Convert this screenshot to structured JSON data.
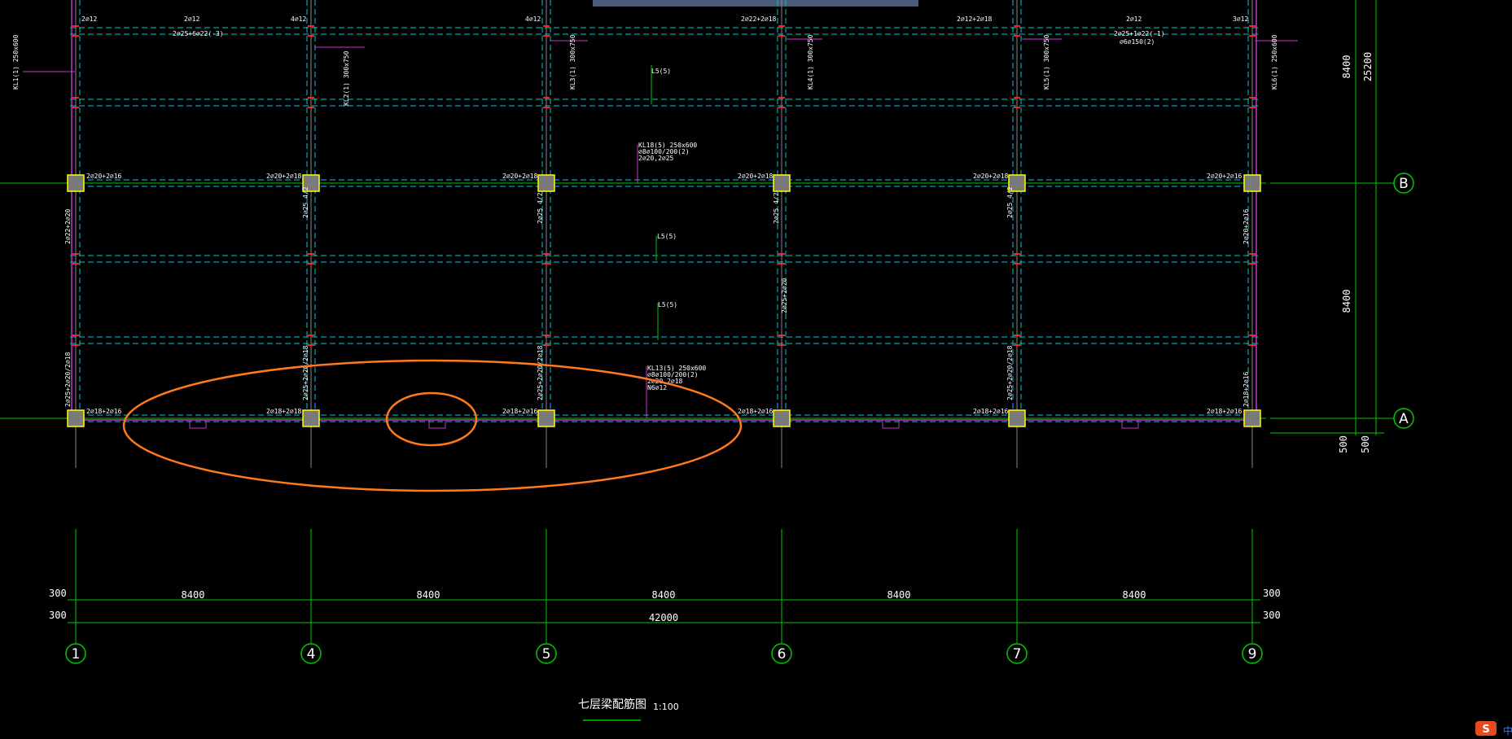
{
  "drawing": {
    "title": "七层梁配筋图",
    "scale": "1:100",
    "colors": {
      "background": "#000000",
      "grid_line": "#00c800",
      "beam_dashed": "#00c8d8",
      "column_fill": "#7a7a7a",
      "column_edge": "#ffff00",
      "magenta": "#cc33cc",
      "orange_markup": "#ff7a1a",
      "red_mark": "#ff2020",
      "text": "#ffffff"
    }
  },
  "axes": {
    "vertical": [
      "1",
      "4",
      "5",
      "6",
      "7",
      "9"
    ],
    "horizontal": [
      "B",
      "A"
    ]
  },
  "dimensions": {
    "bay_width": "8400",
    "bays": [
      "8400",
      "8400",
      "8400",
      "8400",
      "8400"
    ],
    "total": "42000",
    "edge_offset": "300",
    "edge_offset_2": "300",
    "right_side": {
      "span_upper": "8400",
      "span_lower": "8400",
      "total": "25200",
      "offset_a": "500",
      "offset_b": "500"
    }
  },
  "annotations": {
    "top_row": [
      "2⌀12",
      "2⌀12",
      "4⌀12",
      "4⌀12",
      "2⌀22+2⌀18",
      "2⌀12+2⌀18",
      "2⌀12",
      "3⌀12"
    ],
    "top_row_2": [
      "2⌀25+6⌀22(-3)",
      "2⌀25+1⌀22(-1)",
      "⌀6⌀150(2)"
    ],
    "b_line": [
      "2⌀20+2⌀16",
      "2⌀20+2⌀18",
      "2⌀20+2⌀18",
      "2⌀20+2⌀18",
      "2⌀20+2⌀18",
      "2⌀20+2⌀16"
    ],
    "a_line": [
      "2⌀18+2⌀16",
      "2⌀18+2⌀18",
      "2⌀18+2⌀16",
      "2⌀18+2⌀16",
      "2⌀18+2⌀16",
      "2⌀18+2⌀16"
    ],
    "secondary_beams": [
      "L5(5)",
      "L5(5)",
      "L5(5)"
    ],
    "beam_callout_b": [
      "KL18(5) 250x600",
      "⌀8⌀100/200(2)",
      "2⌀20,2⌀25"
    ],
    "beam_callout_a": [
      "KL13(5) 250x600",
      "⌀8⌀100/200(2)",
      "2⌀20,2⌀18",
      "N6⌀12"
    ],
    "vertical_notes": [
      "2⌀22+2⌀20",
      "2⌀25 4/2",
      "2⌀25 4/2",
      "2⌀25 4/2",
      "2⌀25 4/2",
      "2⌀20+2⌀16",
      "2⌀25+2⌀20",
      "2⌀25+2⌀20/2⌀18",
      "2⌀25+2⌀20/2⌀18",
      "2⌀25+2⌀20/2⌀18",
      "2⌀25+2⌀20/2⌀18",
      "2⌀18+2⌀16"
    ],
    "column_callouts": [
      "KL1(1) 250x600",
      "KL2(1) 300x750",
      "KL3(1) 300x750",
      "KL4(1) 300x750",
      "KL5(1) 300x750",
      "KL6(1) 250x600"
    ]
  },
  "markup": {
    "ellipses": 2
  },
  "corner_badge": {
    "glyph": "S",
    "text": "中"
  }
}
